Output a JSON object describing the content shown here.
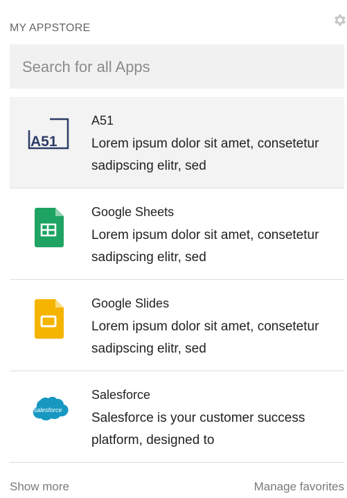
{
  "header": {
    "title": "MY APPSTORE"
  },
  "search": {
    "placeholder": "Search for all Apps"
  },
  "apps": [
    {
      "name": "A51",
      "description": "Lorem ipsum dolor sit amet, consetetur sadipscing elitr, sed",
      "icon": "a51-logo-icon",
      "highlighted": true
    },
    {
      "name": "Google Sheets",
      "description": "Lorem ipsum dolor sit amet, consetetur sadipscing elitr, sed",
      "icon": "google-sheets-icon",
      "highlighted": false
    },
    {
      "name": "Google Slides",
      "description": "Lorem ipsum dolor sit amet, consetetur sadipscing elitr, sed",
      "icon": "google-slides-icon",
      "highlighted": false
    },
    {
      "name": "Salesforce",
      "description": "Salesforce is your customer success platform, designed to",
      "icon": "salesforce-icon",
      "logo_text": "salesforce",
      "highlighted": false
    }
  ],
  "footer": {
    "show_more": "Show more",
    "manage_favorites": "Manage favorites"
  },
  "colors": {
    "a51": "#2d3b66",
    "sheets": "#1ea362",
    "slides": "#f5b400",
    "salesforce": "#1798c1"
  }
}
